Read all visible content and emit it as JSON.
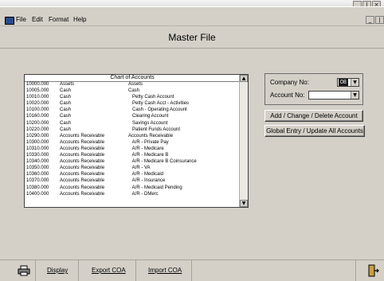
{
  "window_controls": [
    "_",
    "❘",
    "×"
  ],
  "menu": {
    "items": [
      "File",
      "Edit",
      "Format",
      "Help"
    ],
    "mdi_controls": [
      "_",
      "❘"
    ]
  },
  "page": {
    "title": "Master File"
  },
  "chart_of_accounts": {
    "title": "Chart of Accounts",
    "rows": [
      {
        "number": "10000.000",
        "category": "Assets",
        "description": "Assets"
      },
      {
        "number": "10005.000",
        "category": "Cash",
        "description": "Cash"
      },
      {
        "number": "10010.000",
        "category": "Cash",
        "description": "   Petty Cash Account"
      },
      {
        "number": "10020.000",
        "category": "Cash",
        "description": "   Petty Cash Acct - Activities"
      },
      {
        "number": "10100.000",
        "category": "Cash",
        "description": "   Cash - Operating Account"
      },
      {
        "number": "10160.000",
        "category": "Cash",
        "description": "   Clearing Account"
      },
      {
        "number": "10200.000",
        "category": "Cash",
        "description": "   Savings Account"
      },
      {
        "number": "10220.000",
        "category": "Cash",
        "description": "   Patient Funds Account"
      },
      {
        "number": "10290.000",
        "category": "Accounts Receivable",
        "description": "Accounts Receivable"
      },
      {
        "number": "10300.000",
        "category": "Accounts Receivable",
        "description": "   A/R - Private Pay"
      },
      {
        "number": "10310.000",
        "category": "Accounts Receivable",
        "description": "   A/R - Medicare"
      },
      {
        "number": "10330.000",
        "category": "Accounts Receivable",
        "description": "   A/R - Medicare B"
      },
      {
        "number": "10340.000",
        "category": "Accounts Receivable",
        "description": "   A/R - Medicare B Coinsurance"
      },
      {
        "number": "10350.000",
        "category": "Accounts Receivable",
        "description": "   A/R - VA"
      },
      {
        "number": "10360.000",
        "category": "Accounts Receivable",
        "description": "   A/R - Medicaid"
      },
      {
        "number": "10370.000",
        "category": "Accounts Receivable",
        "description": "   A/R - Insurance"
      },
      {
        "number": "10380.000",
        "category": "Accounts Receivable",
        "description": "   A/R - Medicaid Pending"
      },
      {
        "number": "10400.000",
        "category": "Accounts Receivable",
        "description": "   A/R - DMerc"
      }
    ],
    "scroll_up": "▲",
    "scroll_down": "▼"
  },
  "company_panel": {
    "company_label": "Company No:",
    "company_value": "08",
    "account_label": "Account No:",
    "account_value": "",
    "dropdown_arrow": "▼"
  },
  "buttons": {
    "add_change_delete": "Add / Change / Delete Account",
    "global_entry": "Global Entry / Update All Accounts"
  },
  "bottom_bar": {
    "display": "Display",
    "export": "Export COA",
    "import": "Import COA"
  },
  "icons": {
    "print": "printer-icon",
    "exit": "exit-door-icon"
  }
}
